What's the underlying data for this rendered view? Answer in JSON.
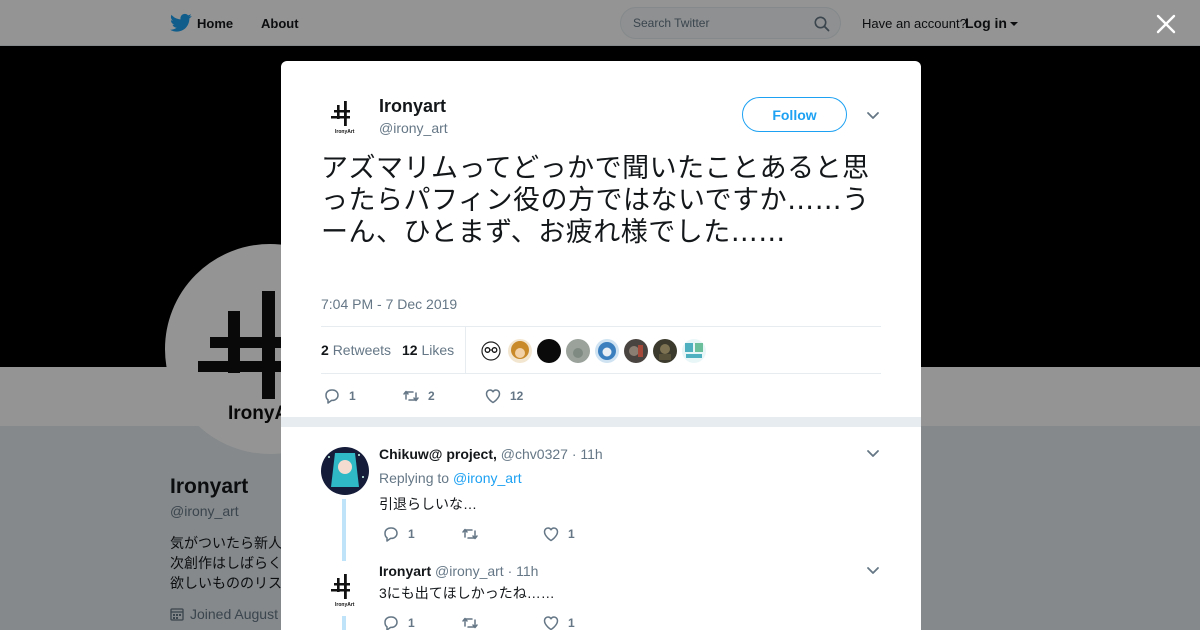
{
  "nav": {
    "home_label": "Home",
    "about_label": "About",
    "search_placeholder": "Search Twitter",
    "have_account": "Have an account?",
    "login_label": "Log in"
  },
  "profile": {
    "name": "Ironyart",
    "handle": "@irony_art",
    "bio_lines": [
      "気がついたら新人",
      "次創作はしばらく",
      "欲しいもののリス"
    ],
    "joined": "Joined August"
  },
  "tweet": {
    "author_name": "Ironyart",
    "author_handle": "@irony_art",
    "follow_label": "Follow",
    "text": "アズマリムってどっかで聞いたことあると思ったらパフィン役の方ではないですか……うーん、ひとまず、お疲れ様でした……",
    "timestamp": "7:04 PM - 7 Dec 2019",
    "retweets_count": "2",
    "retweets_label": "Retweets",
    "likes_count": "12",
    "likes_label": "Likes",
    "actions": {
      "replies": "1",
      "retweets": "2",
      "likes": "12"
    }
  },
  "likers": [
    {
      "icon": "avatar-glasses-icon",
      "color": "#ffffff"
    },
    {
      "icon": "avatar-orange-icon",
      "color": "#c98a2a"
    },
    {
      "icon": "avatar-black-icon",
      "color": "#0a0a0a"
    },
    {
      "icon": "avatar-gray-icon",
      "color": "#9aa29b"
    },
    {
      "icon": "avatar-blue-icon",
      "color": "#3b7fbf"
    },
    {
      "icon": "avatar-dark-icon",
      "color": "#4a4440"
    },
    {
      "icon": "avatar-olive-icon",
      "color": "#3b3a2c"
    },
    {
      "icon": "avatar-teal-icon",
      "color": "#4fb0c0"
    }
  ],
  "replies": [
    {
      "name": "Chikuw@ project,",
      "handle": "@chv0327",
      "time": "· 11h",
      "replying_prefix": "Replying to",
      "replying_to": "@irony_art",
      "text": "引退らしいな…",
      "reply_count": "1",
      "retweet_count": "",
      "like_count": "1"
    },
    {
      "name": "Ironyart",
      "handle": "@irony_art",
      "time": "· 11h",
      "text": "3にも出てほしかったね……",
      "reply_count": "1",
      "retweet_count": "",
      "like_count": "1"
    }
  ],
  "colors": {
    "accent": "#1da1f2",
    "muted": "#657786",
    "text": "#14171a",
    "thread": "#bfe4fa"
  }
}
